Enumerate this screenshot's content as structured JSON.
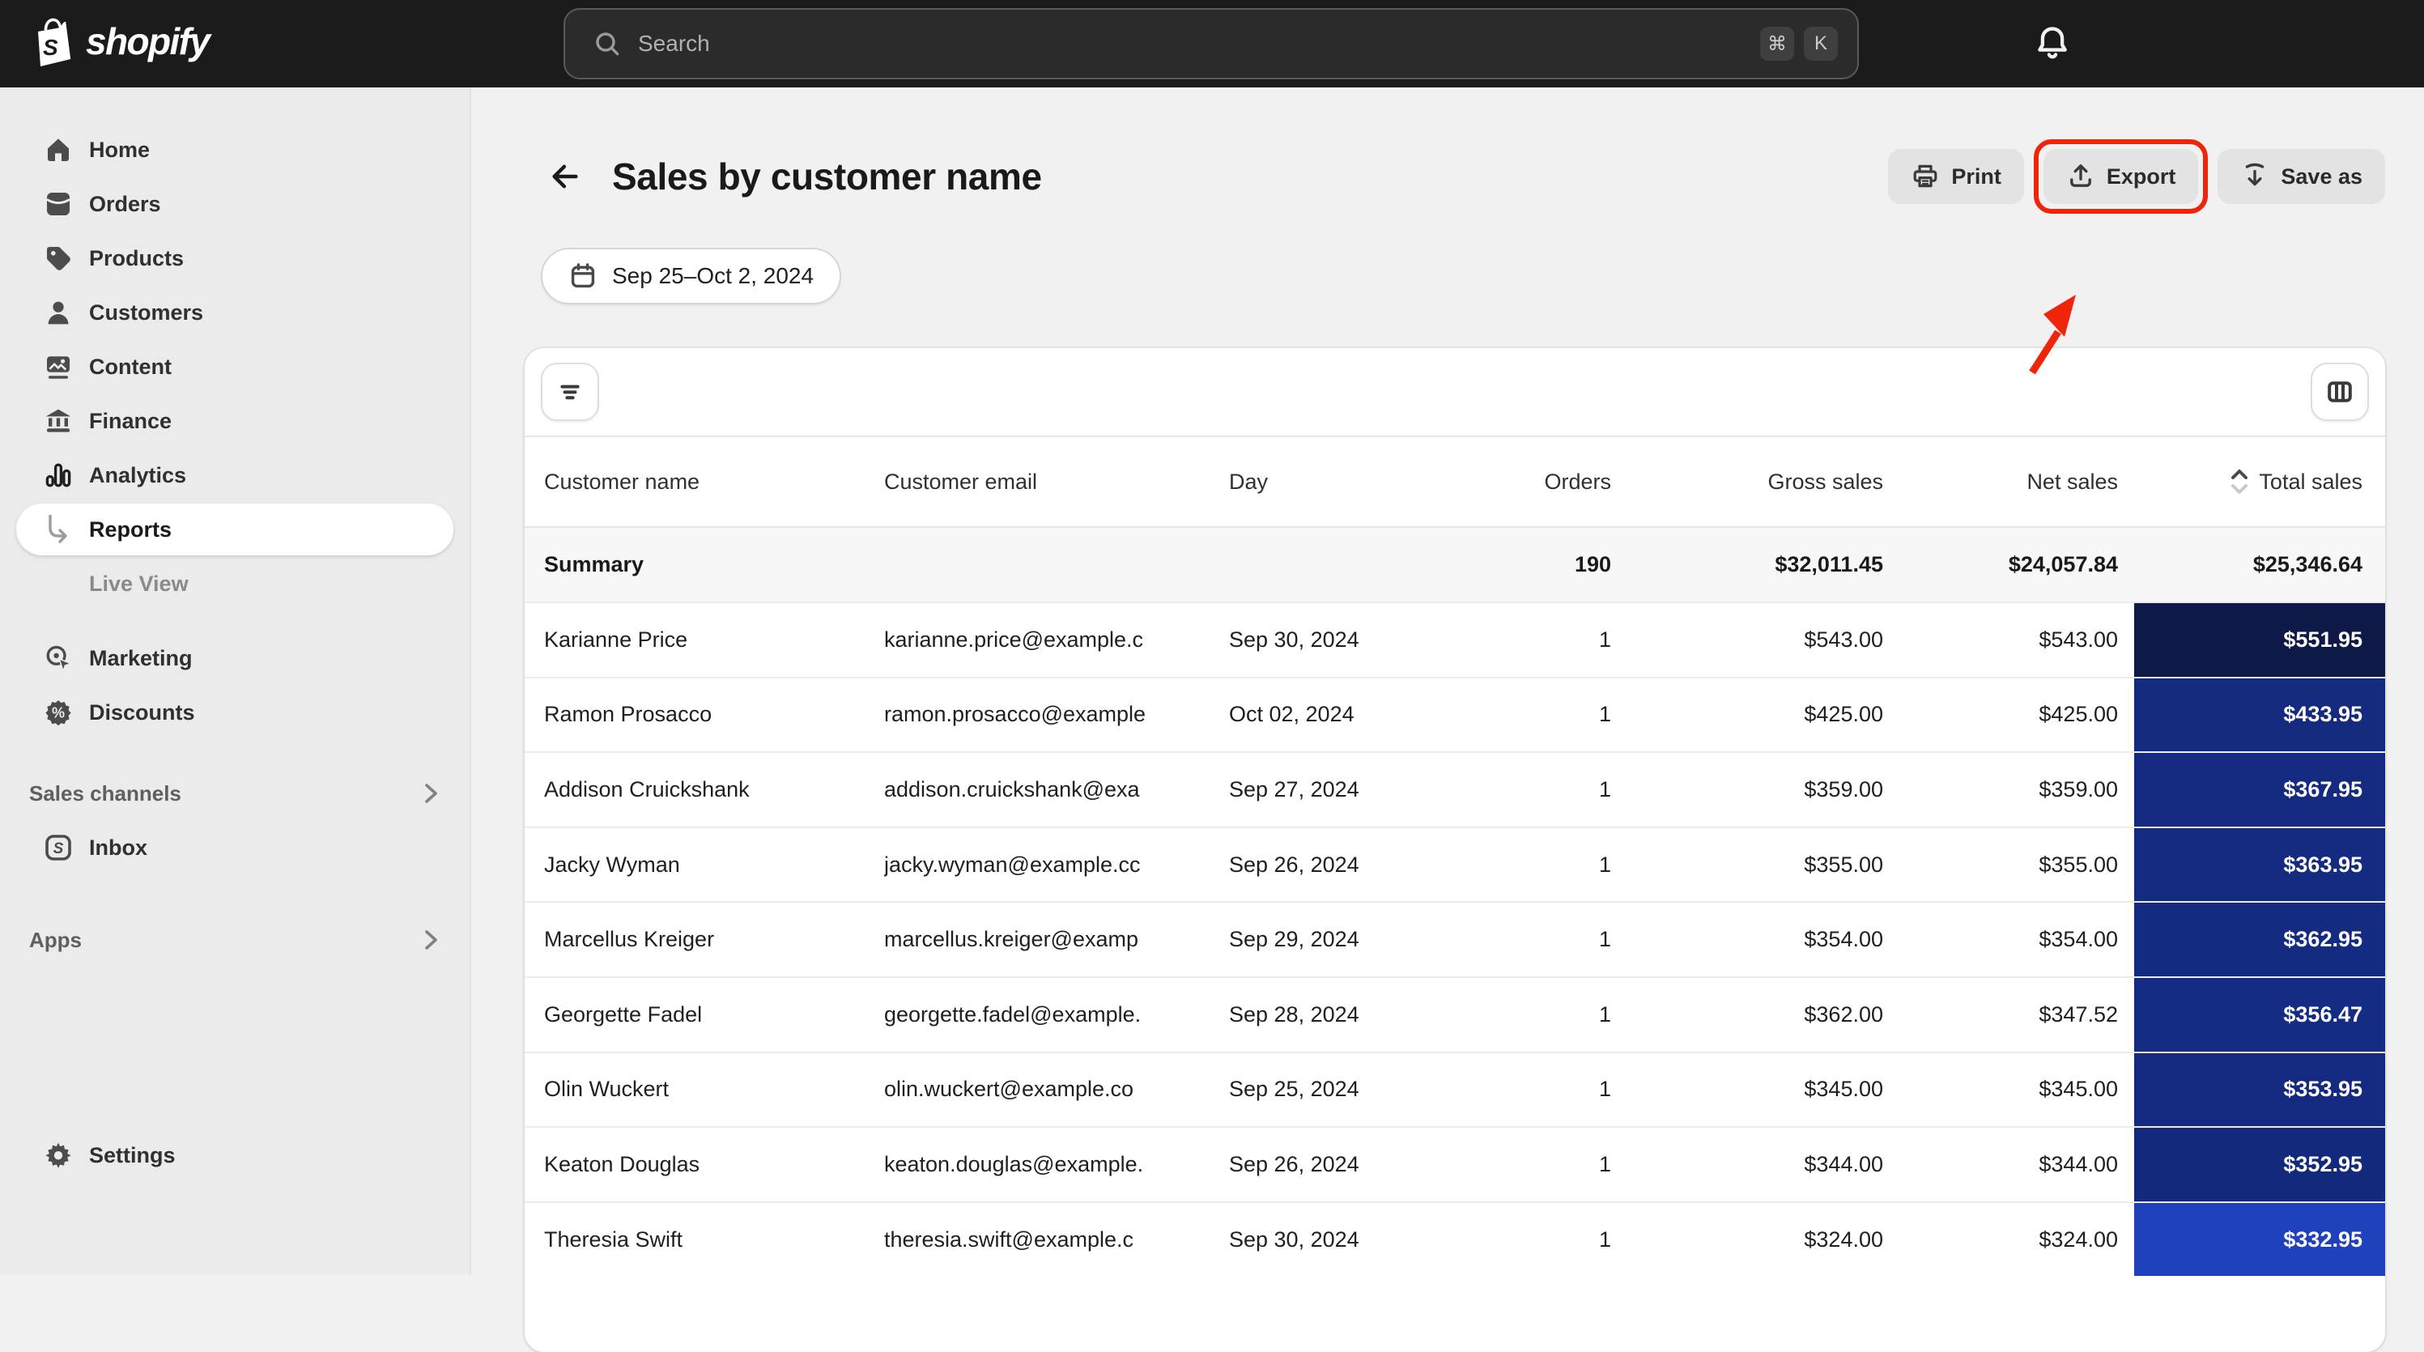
{
  "colors": {
    "topbar_bg": "#1b1b1b",
    "annotation_red": "#ef2409",
    "heatmap_darkest": "#0e1947",
    "heatmap_mid": "#132a7e",
    "heatmap_lightest": "#2041bd"
  },
  "topbar": {
    "brand": "shopify",
    "search": {
      "placeholder": "Search",
      "kbd_cmd": "⌘",
      "kbd_k": "K"
    }
  },
  "sidebar": {
    "home": {
      "label": "Home",
      "icon": "home-icon"
    },
    "orders": {
      "label": "Orders",
      "icon": "orders-icon"
    },
    "products": {
      "label": "Products",
      "icon": "products-icon"
    },
    "customers": {
      "label": "Customers",
      "icon": "customers-icon"
    },
    "content": {
      "label": "Content",
      "icon": "content-icon"
    },
    "finance": {
      "label": "Finance",
      "icon": "finance-icon"
    },
    "analytics": {
      "label": "Analytics",
      "icon": "analytics-icon"
    },
    "reports": {
      "label": "Reports",
      "icon": "sub-arrow-icon",
      "active": true
    },
    "live_view": {
      "label": "Live View"
    },
    "marketing": {
      "label": "Marketing",
      "icon": "marketing-icon"
    },
    "discounts": {
      "label": "Discounts",
      "icon": "discounts-icon"
    },
    "sales_channels": {
      "label": "Sales channels",
      "icon": "chevron-right-icon"
    },
    "inbox": {
      "label": "Inbox",
      "icon": "inbox-icon"
    },
    "apps": {
      "label": "Apps",
      "icon": "chevron-right-icon"
    },
    "settings": {
      "label": "Settings",
      "icon": "gear-icon"
    }
  },
  "page": {
    "title": "Sales by customer name",
    "print_label": "Print",
    "export_label": "Export",
    "save_as_label": "Save as",
    "date_range": "Sep 25–Oct 2, 2024"
  },
  "table": {
    "columns": {
      "name": "Customer name",
      "email": "Customer email",
      "day": "Day",
      "orders": "Orders",
      "gross": "Gross sales",
      "net": "Net sales",
      "total": "Total sales"
    },
    "summary": {
      "label": "Summary",
      "orders": "190",
      "gross": "$32,011.45",
      "net": "$24,057.84",
      "total": "$25,346.64"
    },
    "rows": [
      {
        "name": "Karianne Price",
        "email": "karianne.price@example.c",
        "day": "Sep 30, 2024",
        "orders": "1",
        "gross": "$543.00",
        "net": "$543.00",
        "total": "$551.95",
        "total_bg": "#0e1947"
      },
      {
        "name": "Ramon Prosacco",
        "email": "ramon.prosacco@example",
        "day": "Oct 02, 2024",
        "orders": "1",
        "gross": "$425.00",
        "net": "$425.00",
        "total": "$433.95",
        "total_bg": "#132a7e"
      },
      {
        "name": "Addison Cruickshank",
        "email": "addison.cruickshank@exa",
        "day": "Sep 27, 2024",
        "orders": "1",
        "gross": "$359.00",
        "net": "$359.00",
        "total": "$367.95",
        "total_bg": "#132a80"
      },
      {
        "name": "Jacky Wyman",
        "email": "jacky.wyman@example.cc",
        "day": "Sep 26, 2024",
        "orders": "1",
        "gross": "$355.00",
        "net": "$355.00",
        "total": "$363.95",
        "total_bg": "#142b81"
      },
      {
        "name": "Marcellus Kreiger",
        "email": "marcellus.kreiger@examp",
        "day": "Sep 29, 2024",
        "orders": "1",
        "gross": "$354.00",
        "net": "$354.00",
        "total": "$362.95",
        "total_bg": "#142b82"
      },
      {
        "name": "Georgette Fadel",
        "email": "georgette.fadel@example.",
        "day": "Sep 28, 2024",
        "orders": "1",
        "gross": "$362.00",
        "net": "$347.52",
        "total": "$356.47",
        "total_bg": "#142c83"
      },
      {
        "name": "Olin Wuckert",
        "email": "olin.wuckert@example.co",
        "day": "Sep 25, 2024",
        "orders": "1",
        "gross": "$345.00",
        "net": "$345.00",
        "total": "$353.95",
        "total_bg": "#132a80"
      },
      {
        "name": "Keaton Douglas",
        "email": "keaton.douglas@example.",
        "day": "Sep 26, 2024",
        "orders": "1",
        "gross": "$344.00",
        "net": "$344.00",
        "total": "$352.95",
        "total_bg": "#12297c"
      },
      {
        "name": "Theresia Swift",
        "email": "theresia.swift@example.c",
        "day": "Sep 30, 2024",
        "orders": "1",
        "gross": "$324.00",
        "net": "$324.00",
        "total": "$332.95",
        "total_bg": "#2041bd"
      }
    ]
  }
}
